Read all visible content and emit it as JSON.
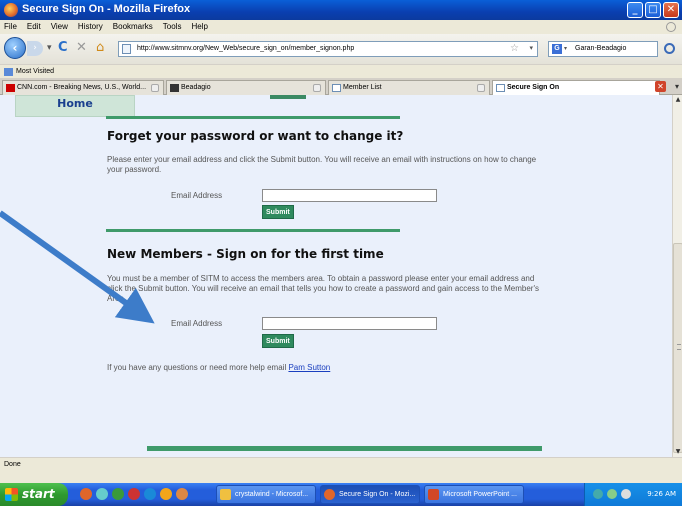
{
  "window": {
    "title": "Secure Sign On - Mozilla Firefox"
  },
  "menu": [
    "File",
    "Edit",
    "View",
    "History",
    "Bookmarks",
    "Tools",
    "Help"
  ],
  "nav": {
    "url": "http://www.sitmnv.org/New_Web/secure_sign_on/member_signon.php",
    "search_engine_label": "Garan-Beadagio"
  },
  "bookmarks": {
    "most_visited": "Most Visited"
  },
  "tabs": [
    {
      "label": "CNN.com - Breaking News, U.S., World...",
      "active": false
    },
    {
      "label": "Beadagio",
      "active": false
    },
    {
      "label": "Member List",
      "active": false
    },
    {
      "label": "Secure Sign On",
      "active": true
    }
  ],
  "page": {
    "home_label": "Home",
    "forgot": {
      "heading": "Forget your password or want to change it?",
      "text": "Please enter your email address and click the Submit button. You will receive an email with instructions on how to change your password.",
      "email_label": "Email Address",
      "submit_label": "Submit"
    },
    "new_members": {
      "heading": "New Members - Sign on for the first time",
      "text": "You must be a member of SITM to access the members area. To obtain a password please enter your email address and click the Submit button. You will receive an email that tells you how to create a password and gain access to the Member's Area.",
      "email_label": "Email Address",
      "submit_label": "Submit"
    },
    "help_text": "If you have any questions or need more help email ",
    "help_link": "Pam Sutton"
  },
  "status": {
    "text": "Done"
  },
  "taskbar": {
    "start_label": "start",
    "tasks": [
      {
        "label": "crystalwind - Microsof...",
        "active": false
      },
      {
        "label": "Secure Sign On - Mozi...",
        "active": true
      },
      {
        "label": "Microsoft PowerPoint ...",
        "active": false
      }
    ],
    "clock": "9:26 AM"
  },
  "colors": {
    "accent_green": "#3f9a6a",
    "link_blue": "#1a3fbf",
    "annotation_arrow": "#3d7cc9"
  }
}
